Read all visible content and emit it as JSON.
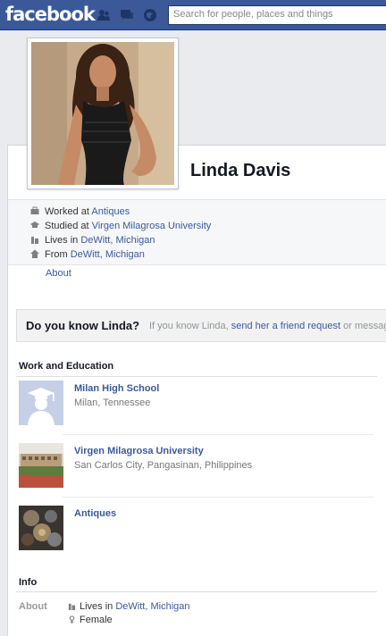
{
  "topbar": {
    "logo": "facebook",
    "search_placeholder": "Search for people, places and things",
    "icons": [
      "friend-requests-icon",
      "messages-icon",
      "notifications-icon"
    ]
  },
  "profile": {
    "name": "Linda Davis",
    "facts": [
      {
        "icon": "briefcase-icon",
        "prefix": "Worked at ",
        "link": "Antiques"
      },
      {
        "icon": "graduation-cap-icon",
        "prefix": "Studied at ",
        "link": "Virgen Milagrosa University"
      },
      {
        "icon": "city-icon",
        "prefix": "Lives in ",
        "link": "DeWitt, Michigan"
      },
      {
        "icon": "home-icon",
        "prefix": "From ",
        "link": "DeWitt, Michigan"
      }
    ],
    "about_tab": "About"
  },
  "know_box": {
    "title": "Do you know Linda?",
    "text_before": "If you know Linda, ",
    "link": "send her a friend request",
    "text_after": " or messag"
  },
  "work_education": {
    "title": "Work and Education",
    "entries": [
      {
        "title": "Milan High School",
        "subtitle": "Milan, Tennessee",
        "thumb": "school-silhouette-icon"
      },
      {
        "title": "Virgen Milagrosa University",
        "subtitle": "San Carlos City, Pangasinan, Philippines",
        "thumb": "university-photo"
      },
      {
        "title": "Antiques",
        "subtitle": "",
        "thumb": "antiques-photo"
      }
    ]
  },
  "info": {
    "title": "Info",
    "about_label": "About",
    "lives_prefix": "Lives in ",
    "lives_link": "DeWitt, Michigan",
    "gender": "Female"
  },
  "colors": {
    "brand": "#3b5998",
    "link": "#3b5998",
    "background": "#e9ebee"
  }
}
